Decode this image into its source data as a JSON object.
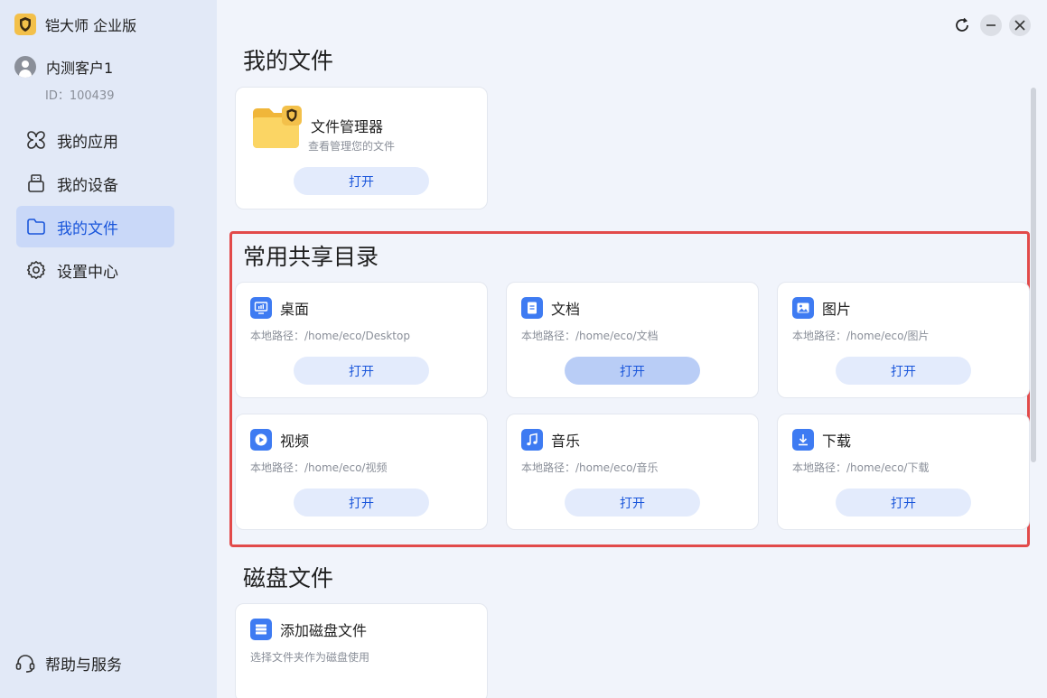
{
  "app": {
    "name": "铠大师 企业版"
  },
  "user": {
    "name": "内测客户1",
    "id": "ID：100439"
  },
  "nav": [
    {
      "label": "我的应用",
      "icon": "apps-icon"
    },
    {
      "label": "我的设备",
      "icon": "usb-device-icon"
    },
    {
      "label": "我的文件",
      "icon": "folder-icon",
      "active": true
    },
    {
      "label": "设置中心",
      "icon": "gear-icon"
    }
  ],
  "help": {
    "label": "帮助与服务"
  },
  "sections": {
    "my_files": "我的文件",
    "shared": "常用共享目录",
    "disk": "磁盘文件"
  },
  "file_manager": {
    "name": "文件管理器",
    "desc": "查看管理您的文件",
    "button": "打开"
  },
  "shared_dirs": [
    {
      "name": "桌面",
      "path": "本地路径：/home/eco/Desktop",
      "button": "打开",
      "icon": "desktop-icon"
    },
    {
      "name": "文档",
      "path": "本地路径：/home/eco/文档",
      "button": "打开",
      "icon": "document-icon",
      "hover": true
    },
    {
      "name": "图片",
      "path": "本地路径：/home/eco/图片",
      "button": "打开",
      "icon": "image-icon"
    },
    {
      "name": "视频",
      "path": "本地路径：/home/eco/视频",
      "button": "打开",
      "icon": "video-icon"
    },
    {
      "name": "音乐",
      "path": "本地路径：/home/eco/音乐",
      "button": "打开",
      "icon": "music-icon"
    },
    {
      "name": "下载",
      "path": "本地路径：/home/eco/下载",
      "button": "打开",
      "icon": "download-icon"
    }
  ],
  "disk": {
    "name": "添加磁盘文件",
    "desc": "选择文件夹作为磁盘使用"
  },
  "colors": {
    "accent": "#1a56db",
    "highlight": "#e24a4a",
    "sidebar": "#e2e9f7"
  }
}
